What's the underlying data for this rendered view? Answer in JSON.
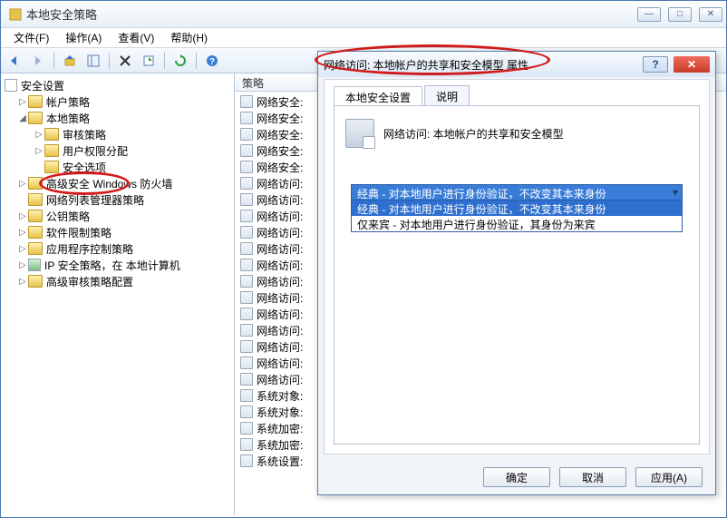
{
  "window": {
    "title": "本地安全策略"
  },
  "menu": {
    "file": "文件(F)",
    "action": "操作(A)",
    "view": "查看(V)",
    "help": "帮助(H)"
  },
  "tree": {
    "root": "安全设置",
    "items": [
      {
        "twist": "▷",
        "label": "帐户策略",
        "indent": 1
      },
      {
        "twist": "◢",
        "label": "本地策略",
        "indent": 1
      },
      {
        "twist": "▷",
        "label": "审核策略",
        "indent": 2
      },
      {
        "twist": "▷",
        "label": "用户权限分配",
        "indent": 2
      },
      {
        "twist": "",
        "label": "安全选项",
        "indent": 2,
        "hl": true
      },
      {
        "twist": "▷",
        "label": "高级安全 Windows 防火墙",
        "indent": 1
      },
      {
        "twist": "",
        "label": "网络列表管理器策略",
        "indent": 1
      },
      {
        "twist": "▷",
        "label": "公钥策略",
        "indent": 1
      },
      {
        "twist": "▷",
        "label": "软件限制策略",
        "indent": 1
      },
      {
        "twist": "▷",
        "label": "应用程序控制策略",
        "indent": 1
      },
      {
        "twist": "▷",
        "label": "IP 安全策略，在 本地计算机",
        "indent": 1,
        "ip": true
      },
      {
        "twist": "▷",
        "label": "高级审核策略配置",
        "indent": 1
      }
    ]
  },
  "center": {
    "header": "策略",
    "rows": [
      "网络安全:",
      "网络安全:",
      "网络安全:",
      "网络安全:",
      "网络安全:",
      "网络访问:",
      "网络访问:",
      "网络访问:",
      "网络访问:",
      "网络访问:",
      "网络访问:",
      "网络访问:",
      "网络访问:",
      "网络访问:",
      "网络访问:",
      "网络访问:",
      "网络访问:",
      "网络访问:",
      "系统对象:",
      "系统对象:",
      "系统加密:",
      "系统加密:",
      "系统设置:"
    ]
  },
  "dialog": {
    "title": "网络访问: 本地帐户的共享和安全模型 属性",
    "tabs": {
      "t1": "本地安全设置",
      "t2": "说明"
    },
    "desc": "网络访问: 本地帐户的共享和安全模型",
    "dropdown": {
      "selected": "经典 - 对本地用户进行身份验证，不改变其本来身份",
      "opt1": "经典 - 对本地用户进行身份验证，不改变其本来身份",
      "opt2": "仅来宾 - 对本地用户进行身份验证，其身份为来宾"
    },
    "buttons": {
      "ok": "确定",
      "cancel": "取消",
      "apply": "应用(A)"
    }
  }
}
